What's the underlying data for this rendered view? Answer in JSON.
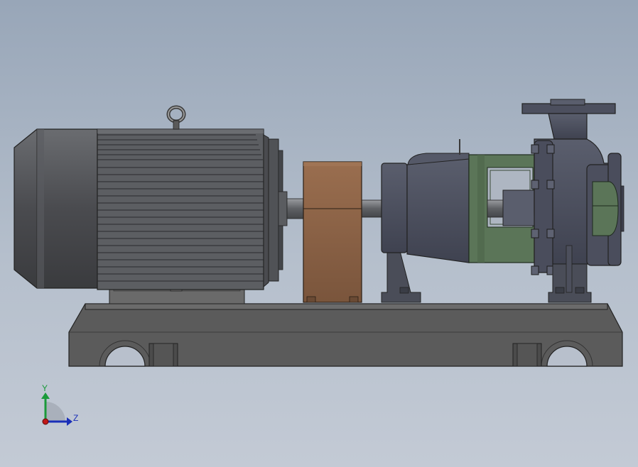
{
  "viewport": {
    "model": "centrifugal-pump-assembly",
    "view": "side"
  },
  "triad": {
    "y_label": "Y",
    "z_label": "Z",
    "colors": {
      "y": "#1a9a3a",
      "z": "#1a2fb8",
      "x": "#c01818"
    }
  },
  "colors": {
    "motor": "#5c5e63",
    "motor_dark": "#3c3d41",
    "coupling_guard": "#8a6247",
    "pump": "#4e5260",
    "bracket": "#5b7558",
    "baseplate": "#5a5a5a"
  }
}
